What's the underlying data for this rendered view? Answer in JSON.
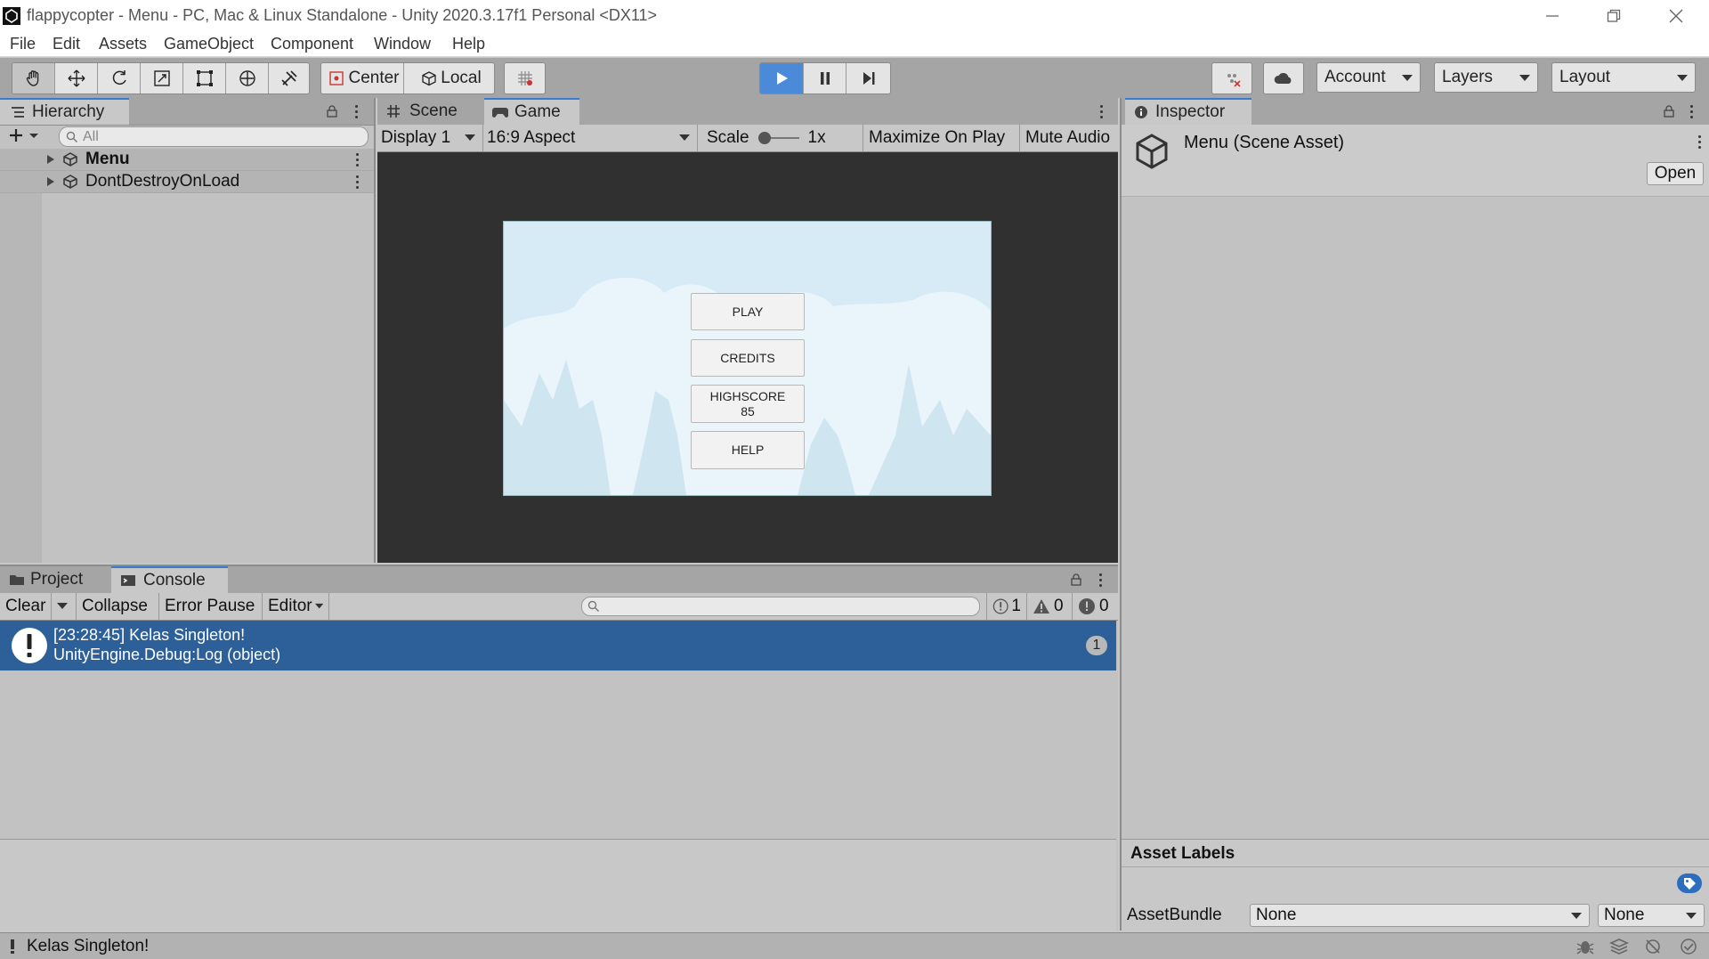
{
  "window": {
    "title": "flappycopter - Menu - PC, Mac & Linux Standalone - Unity 2020.3.17f1 Personal <DX11>"
  },
  "menu": {
    "file": "File",
    "edit": "Edit",
    "assets": "Assets",
    "gameobject": "GameObject",
    "component": "Component",
    "window": "Window",
    "help": "Help"
  },
  "toolbar": {
    "pivot": "Center",
    "space": "Local",
    "account": "Account",
    "layers": "Layers",
    "layout": "Layout"
  },
  "hierarchy": {
    "tab": "Hierarchy",
    "search_placeholder": "All",
    "items": [
      {
        "label": "Menu",
        "bold": true
      },
      {
        "label": "DontDestroyOnLoad",
        "bold": false
      }
    ]
  },
  "center": {
    "tabs": {
      "scene": "Scene",
      "game": "Game"
    },
    "display": "Display 1",
    "aspect": "16:9 Aspect",
    "scale_label": "Scale",
    "scale_value": "1x",
    "maximize": "Maximize On Play",
    "mute": "Mute Audio"
  },
  "game": {
    "buttons": {
      "play": "PLAY",
      "credits": "CREDITS",
      "highscore": "HIGHSCORE",
      "highscore_value": "85",
      "help": "HELP"
    }
  },
  "inspector": {
    "tab": "Inspector",
    "asset_title": "Menu (Scene Asset)",
    "open": "Open",
    "asset_labels": "Asset Labels",
    "assetbundle_label": "AssetBundle",
    "assetbundle_value": "None",
    "variant_value": "None"
  },
  "console": {
    "tabs": {
      "project": "Project",
      "console": "Console"
    },
    "clear": "Clear",
    "collapse": "Collapse",
    "error_pause": "Error Pause",
    "editor": "Editor",
    "log_count": "1",
    "warn_count": "0",
    "error_count": "0",
    "log_line1": "[23:28:45] Kelas Singleton!",
    "log_line2": "UnityEngine.Debug:Log (object)",
    "log_badge": "1"
  },
  "status": {
    "message": "Kelas Singleton!"
  },
  "colors": {
    "selection": "#2d5f99",
    "tab_accent": "#3a79d4",
    "play_active": "#4b8ad9",
    "sky": "#d6ebf5"
  }
}
